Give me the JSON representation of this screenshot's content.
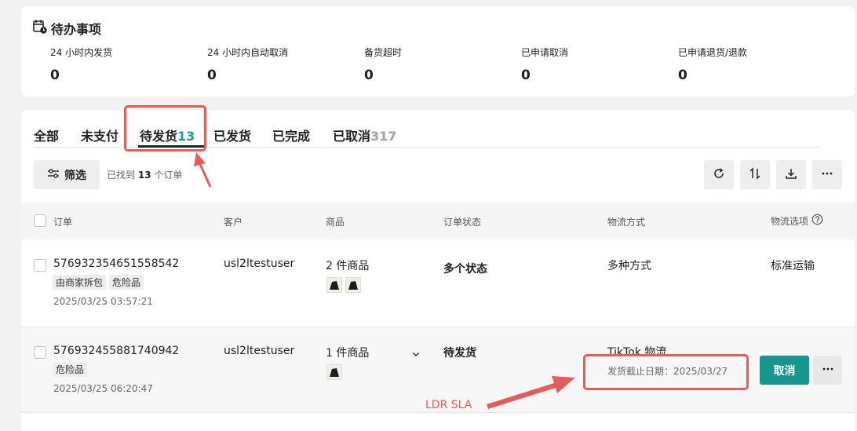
{
  "todo": {
    "title": "待办事项",
    "stats": [
      {
        "label": "24 小时内发货",
        "value": "0"
      },
      {
        "label": "24 小时内自动取消",
        "value": "0"
      },
      {
        "label": "备货超时",
        "value": "0"
      },
      {
        "label": "已申请取消",
        "value": "0"
      },
      {
        "label": "已申请退货/退款",
        "value": "0"
      }
    ]
  },
  "tabs": [
    {
      "label": "全部",
      "count": ""
    },
    {
      "label": "未支付",
      "count": ""
    },
    {
      "label": "待发货",
      "count": "13",
      "active": true
    },
    {
      "label": "已发货",
      "count": ""
    },
    {
      "label": "已完成",
      "count": ""
    },
    {
      "label": "已取消",
      "count": "317"
    }
  ],
  "toolbar": {
    "filter_label": "筛选",
    "found_prefix": "已找到",
    "found_count": "13",
    "found_suffix": "个订单"
  },
  "table": {
    "headers": [
      "订单",
      "客户",
      "商品",
      "订单状态",
      "物流方式",
      "物流选项"
    ],
    "rows": [
      {
        "order_id": "576932354651558542",
        "tags": [
          "由商家拆包",
          "危险品"
        ],
        "time": "2025/03/25 03:57:21",
        "customer": "usl2ltestuser",
        "items": "2 件商品",
        "status": "多个状态",
        "shipping": "多种方式",
        "option": "标准运输"
      },
      {
        "order_id": "576932455881740942",
        "tags": [
          "危险品"
        ],
        "time": "2025/03/25 06:20:47",
        "customer": "usl2ltestuser",
        "items": "1 件商品",
        "status": "待发货",
        "shipping": "TikTok 物流",
        "deadline": "发货截止日期：2025/03/27",
        "action": "取消"
      }
    ]
  },
  "annotation": {
    "label": "LDR SLA",
    "color": "#e45d5d"
  },
  "colors": {
    "accent": "#17958f",
    "tab_count": "#1a9e9a"
  }
}
